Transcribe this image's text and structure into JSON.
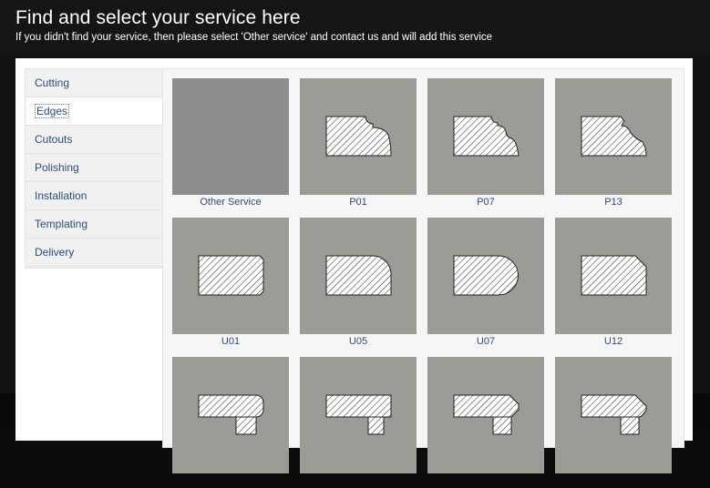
{
  "header": {
    "title": "Find and select your service here",
    "subtitle": "If you didn't find your service, then please select 'Other service' and contact us and will add this service"
  },
  "sidebar": {
    "items": [
      {
        "label": "Cutting",
        "active": false
      },
      {
        "label": "Edges",
        "active": true
      },
      {
        "label": "Cutouts",
        "active": false
      },
      {
        "label": "Polishing",
        "active": false
      },
      {
        "label": "Installation",
        "active": false
      },
      {
        "label": "Templating",
        "active": false
      },
      {
        "label": "Delivery",
        "active": false
      }
    ]
  },
  "services": [
    {
      "code": "Other Service",
      "icon": "other-service-icon"
    },
    {
      "code": "P01",
      "icon": "p01-edge-profile-icon"
    },
    {
      "code": "P07",
      "icon": "p07-edge-profile-icon"
    },
    {
      "code": "P13",
      "icon": "p13-edge-profile-icon"
    },
    {
      "code": "U01",
      "icon": "u01-edge-profile-icon"
    },
    {
      "code": "U05",
      "icon": "u05-edge-profile-icon"
    },
    {
      "code": "U07",
      "icon": "u07-edge-profile-icon"
    },
    {
      "code": "U12",
      "icon": "u12-edge-profile-icon"
    },
    {
      "code": "",
      "icon": "laminated-edge-profile-icon"
    },
    {
      "code": "",
      "icon": "laminated-edge-profile-icon"
    },
    {
      "code": "",
      "icon": "laminated-edge-profile-icon"
    },
    {
      "code": "",
      "icon": "laminated-edge-profile-icon"
    }
  ],
  "colors": {
    "accent_text": "#2b4b7c",
    "tile_background": "#9c9b96",
    "page_background": "#0c0c0c"
  }
}
